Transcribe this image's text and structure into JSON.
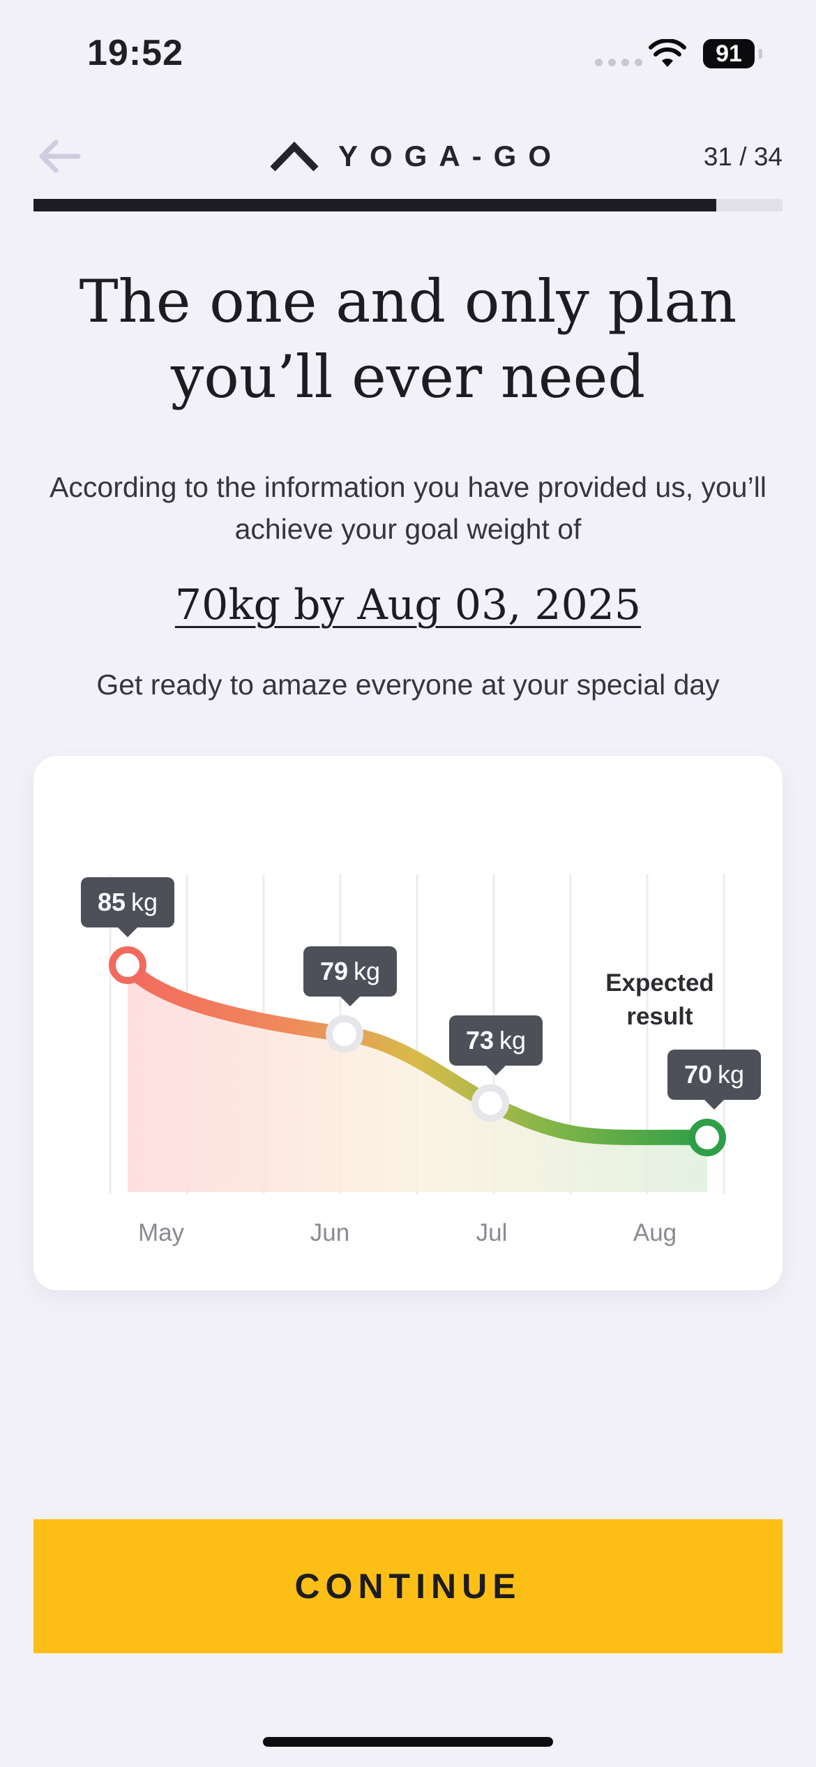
{
  "status_bar": {
    "time": "19:52",
    "battery": "91",
    "icons": [
      "signal-dots-icon",
      "wifi-icon",
      "battery-icon"
    ]
  },
  "header": {
    "back_icon": "arrow-left-icon",
    "logo_icon": "chevron-up-icon",
    "logo_text": "YOGA-GO",
    "step": "31 / 34",
    "progress": 0.912
  },
  "content": {
    "title_line1": "The one and only plan",
    "title_line2": "you’ll ever need",
    "subtitle": "According to the information you have provided us, you’ll achieve your goal weight of",
    "goal": "70kg by Aug 03, 2025",
    "tagline": "Get ready to amaze everyone at your special day"
  },
  "chart": {
    "expected_line1": "Expected",
    "expected_line2": "result",
    "unit": "kg"
  },
  "chart_data": {
    "type": "line",
    "categories": [
      "May",
      "Jun",
      "Jul",
      "Aug"
    ],
    "points": [
      {
        "label": "May",
        "value": 85,
        "value_label": "85"
      },
      {
        "label": "Jun",
        "value": 79,
        "value_label": "79"
      },
      {
        "label": "Jul",
        "value": 73,
        "value_label": "73"
      },
      {
        "label": "Aug",
        "value": 70,
        "value_label": "70"
      }
    ],
    "annotation": "Expected result",
    "colors": {
      "start": "#f26a5e",
      "mid": "#d2c24a",
      "end": "#2e9e48",
      "bubble": "#4d5059"
    }
  },
  "footer": {
    "continue_label": "CONTINUE",
    "accent": "#fdbf16"
  }
}
